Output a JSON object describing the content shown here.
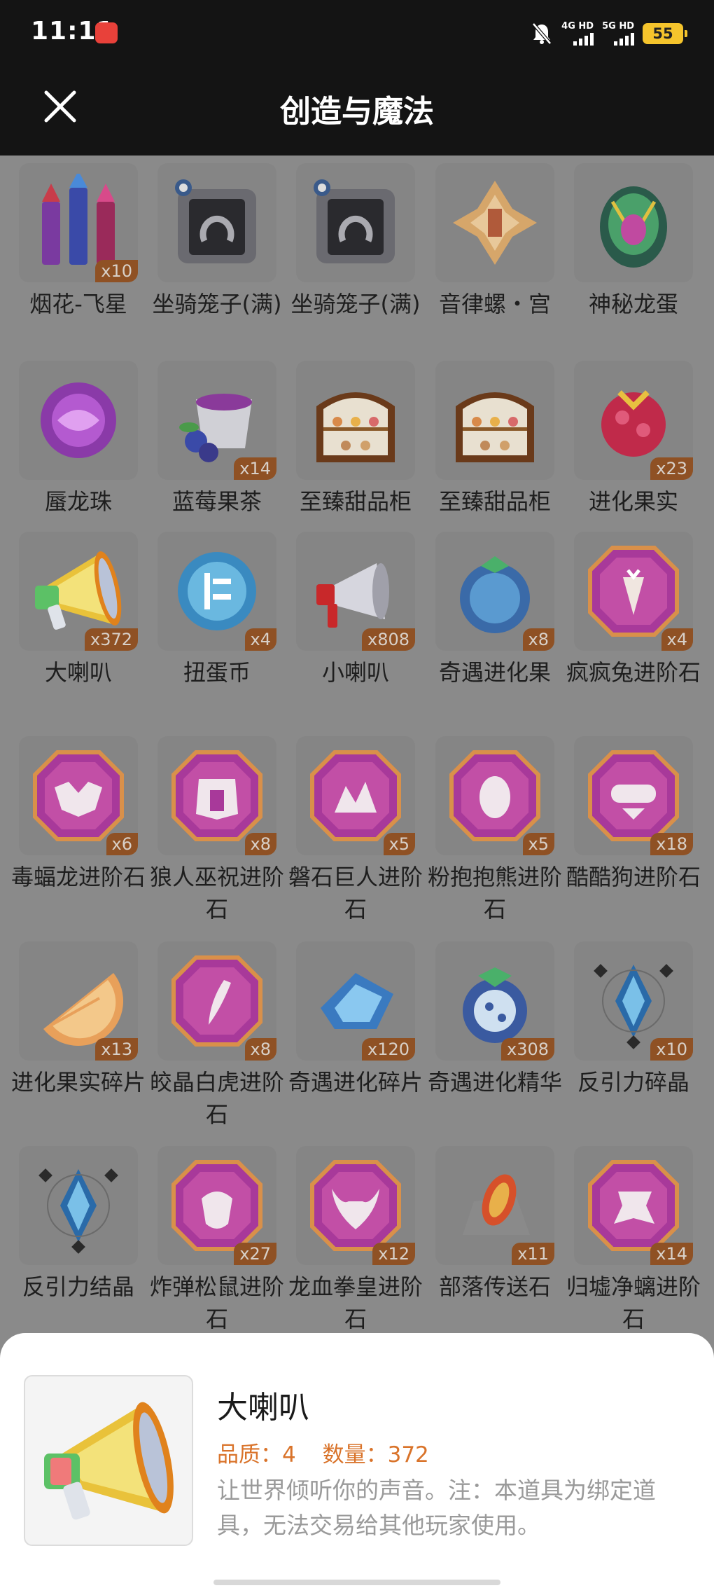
{
  "status_bar": {
    "time": "11:11",
    "network_1": "4G HD",
    "network_2": "5G HD",
    "battery": "55"
  },
  "header": {
    "title": "创造与魔法",
    "close_icon": "close-icon"
  },
  "items": [
    {
      "name": "烟花-飞星",
      "count": "x10",
      "icon": "firework-rockets-icon"
    },
    {
      "name": "坐骑笼子(满)",
      "count": "",
      "icon": "mount-cage-icon"
    },
    {
      "name": "坐骑笼子(满)",
      "count": "",
      "icon": "mount-cage-icon"
    },
    {
      "name": "音律螺・宫",
      "count": "",
      "icon": "conch-shell-icon"
    },
    {
      "name": "神秘龙蛋",
      "count": "",
      "icon": "dragon-egg-icon"
    },
    {
      "name": "蜃龙珠",
      "count": "",
      "icon": "purple-orb-icon"
    },
    {
      "name": "蓝莓果茶",
      "count": "x14",
      "icon": "blueberry-tea-icon"
    },
    {
      "name": "至臻甜品柜",
      "count": "",
      "icon": "dessert-cabinet-icon"
    },
    {
      "name": "至臻甜品柜",
      "count": "",
      "icon": "dessert-cabinet-icon"
    },
    {
      "name": "进化果实",
      "count": "x23",
      "icon": "evolution-fruit-icon"
    },
    {
      "name": "大喇叭",
      "count": "x372",
      "icon": "megaphone-icon"
    },
    {
      "name": "扭蛋币",
      "count": "x4",
      "icon": "gacha-coin-icon"
    },
    {
      "name": "小喇叭",
      "count": "x808",
      "icon": "small-horn-icon"
    },
    {
      "name": "奇遇进化果",
      "count": "x8",
      "icon": "blue-fruit-icon"
    },
    {
      "name": "疯疯兔进阶石",
      "count": "x4",
      "icon": "gem-carrot-icon"
    },
    {
      "name": "毒蝠龙进阶石",
      "count": "x6",
      "icon": "gem-bat-icon"
    },
    {
      "name": "狼人巫祝进阶石",
      "count": "x8",
      "icon": "gem-wolf-icon"
    },
    {
      "name": "磐石巨人进阶石",
      "count": "x5",
      "icon": "gem-rock-icon"
    },
    {
      "name": "粉抱抱熊进阶石",
      "count": "x5",
      "icon": "gem-egg-icon"
    },
    {
      "name": "酷酷狗进阶石",
      "count": "x18",
      "icon": "gem-goggles-icon"
    },
    {
      "name": "进化果实碎片",
      "count": "x13",
      "icon": "fruit-slice-icon"
    },
    {
      "name": "皎晶白虎进阶石",
      "count": "x8",
      "icon": "gem-fang-icon"
    },
    {
      "name": "奇遇进化碎片",
      "count": "x120",
      "icon": "crystal-shard-icon"
    },
    {
      "name": "奇遇进化精华",
      "count": "x308",
      "icon": "fruit-essence-icon"
    },
    {
      "name": "反引力碎晶",
      "count": "x10",
      "icon": "antigravity-crystal-icon"
    },
    {
      "name": "反引力结晶",
      "count": "",
      "icon": "antigravity-crystal-icon"
    },
    {
      "name": "炸弹松鼠进阶石",
      "count": "x27",
      "icon": "gem-acorn-icon"
    },
    {
      "name": "龙血拳皇进阶石",
      "count": "x12",
      "icon": "gem-bull-icon"
    },
    {
      "name": "部落传送石",
      "count": "x11",
      "icon": "teleport-stone-icon"
    },
    {
      "name": "归墟净螭进阶石",
      "count": "x14",
      "icon": "gem-dragon-icon"
    }
  ],
  "detail": {
    "name": "大喇叭",
    "quality_label": "品质：",
    "quality_value": "4",
    "quantity_label": "数量：",
    "quantity_value": "372",
    "description": "让世界倾听你的声音。注：本道具为绑定道具，无法交易给其他玩家使用。",
    "icon": "megaphone-icon"
  },
  "colors": {
    "header_bg": "#141414",
    "accent": "#d9732a",
    "count_badge": "#8f5124",
    "overlay": "#8a8a8a"
  }
}
